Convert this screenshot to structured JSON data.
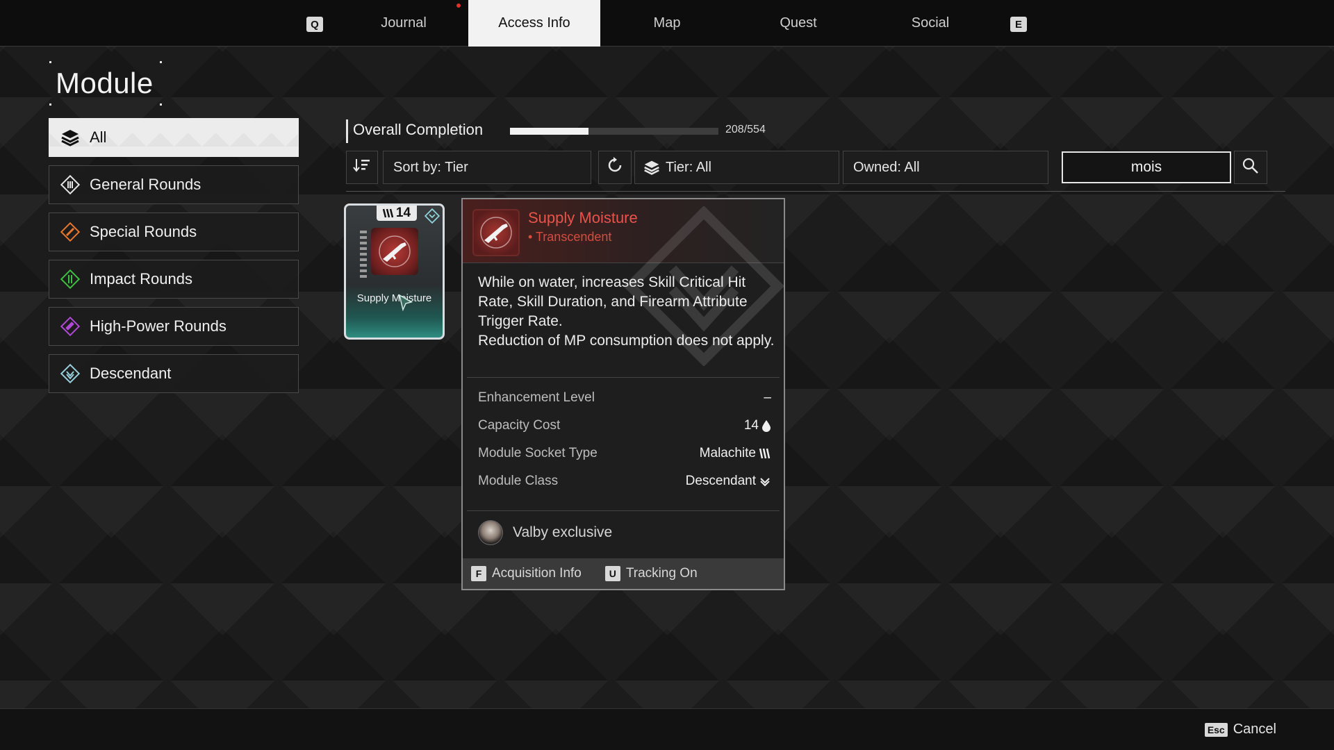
{
  "nav": {
    "prev_key": "Q",
    "next_key": "E",
    "tabs": [
      "Journal",
      "Access Info",
      "Map",
      "Quest",
      "Social"
    ],
    "active_tab": "Access Info"
  },
  "page": {
    "title": "Module"
  },
  "sidebar": {
    "items": [
      {
        "label": "All",
        "icon": "layers-icon",
        "active": true
      },
      {
        "label": "General Rounds",
        "icon": "general-rounds-icon",
        "color": "#e6e6e6"
      },
      {
        "label": "Special Rounds",
        "icon": "special-rounds-icon",
        "color": "#e8772e"
      },
      {
        "label": "Impact Rounds",
        "icon": "impact-rounds-icon",
        "color": "#3fbf3f"
      },
      {
        "label": "High-Power Rounds",
        "icon": "high-power-rounds-icon",
        "color": "#b04ad6"
      },
      {
        "label": "Descendant",
        "icon": "descendant-icon",
        "color": "#9ad0dd"
      }
    ]
  },
  "completion": {
    "label": "Overall Completion",
    "count": "208/554",
    "fraction": 0.3755
  },
  "filters": {
    "sort_label": "Sort by: Tier",
    "tier_label": "Tier: All",
    "owned_label": "Owned: All",
    "search_value": "mois"
  },
  "module_card": {
    "capacity": "14",
    "name": "Supply Moisture"
  },
  "tooltip": {
    "name": "Supply Moisture",
    "tier": "• Transcendent",
    "description": "While on water, increases Skill Critical Hit Rate, Skill Duration, and Firearm Attribute Trigger Rate.\nReduction of MP consumption does not apply.",
    "stats": [
      {
        "key": "Enhancement Level",
        "value": "–"
      },
      {
        "key": "Capacity Cost",
        "value": "14"
      },
      {
        "key": "Module Socket Type",
        "value": "Malachite"
      },
      {
        "key": "Module Class",
        "value": "Descendant"
      }
    ],
    "exclusive": "Valby exclusive",
    "footer": {
      "acq_key": "F",
      "acq_label": "Acquisition Info",
      "track_key": "U",
      "track_label": "Tracking On"
    }
  },
  "bottom": {
    "esc_key": "Esc",
    "cancel_label": "Cancel"
  },
  "colors": {
    "tier_red": "#e8534a",
    "accent_white": "#f2f2f2"
  }
}
